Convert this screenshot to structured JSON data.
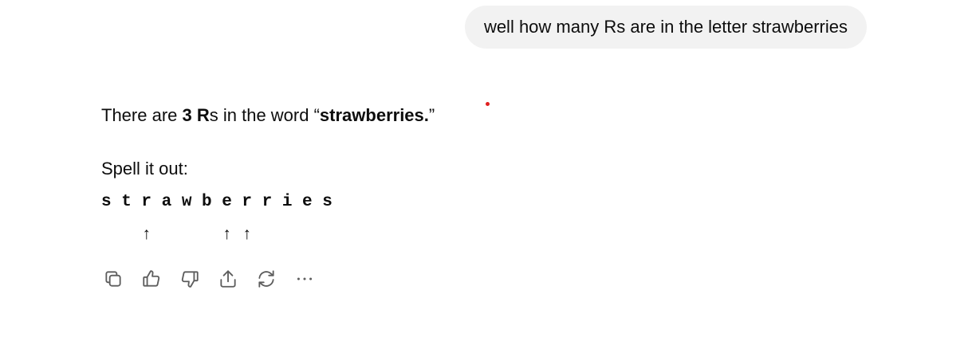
{
  "user_message": {
    "text": "well how many Rs are in the letter strawberries"
  },
  "assistant_message": {
    "answer": {
      "prefix": "There are ",
      "count_bold": "3 R",
      "middle": "s in the word “",
      "word_bold": "strawberries.",
      "suffix": "”"
    },
    "spell_label": "Spell it out:",
    "letters": "s t r a w b e r r i e s",
    "arrows": "    ↑       ↑ ↑"
  },
  "toolbar": {
    "icons": [
      "copy-icon",
      "thumbs-up-icon",
      "thumbs-down-icon",
      "share-icon",
      "regenerate-icon",
      "more-icon"
    ]
  },
  "colors": {
    "bubble_bg": "#f2f2f2",
    "text": "#0d0d0d",
    "icon": "#5d5d5d",
    "dot": "#e02020"
  }
}
